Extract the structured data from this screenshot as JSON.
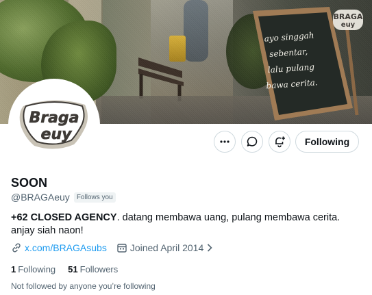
{
  "banner": {
    "chalkboard_lines": [
      "ayo singgah",
      "sebentar,",
      "lalu pulang",
      "bawa cerita."
    ],
    "logo_text_top": "BRAGA",
    "logo_text_bottom": "euy"
  },
  "avatar": {
    "logo_text_top": "Braga",
    "logo_text_bottom": "euy"
  },
  "actions": {
    "more_icon": "more-dots-icon",
    "message_icon": "message-bubble-icon",
    "notify_icon": "bell-plus-icon",
    "follow_label": "Following"
  },
  "profile": {
    "name": "SOON",
    "handle": "@BRAGAeuy",
    "follows_you": "Follows you",
    "bio_strong": "+62 CLOSED AGENCY",
    "bio_rest": ". datang membawa uang, pulang membawa cerita. anjay siah naon!",
    "link": "x.com/BRAGAsubs",
    "joined": "Joined April 2014",
    "following_count": "1",
    "following_label": "Following",
    "followers_count": "51",
    "followers_label": "Followers",
    "not_followed_text": "Not followed by anyone you’re following"
  },
  "colors": {
    "link": "#1d9bf0",
    "secondary_text": "#536471",
    "border": "#cfd9de"
  }
}
